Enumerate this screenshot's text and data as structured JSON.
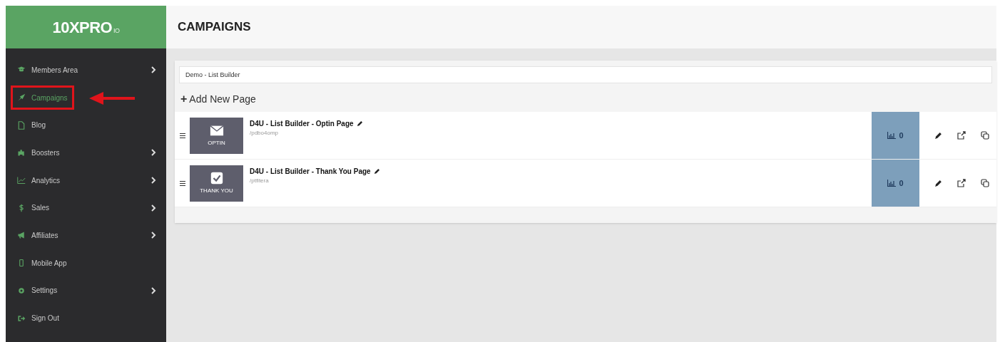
{
  "logo": {
    "text": "10XPRO",
    "suffix": "IO"
  },
  "sidebar": {
    "items": [
      {
        "label": "Members Area",
        "has_submenu": true,
        "selected": false,
        "highlighted": false
      },
      {
        "label": "Campaigns",
        "has_submenu": false,
        "selected": true,
        "highlighted": true
      },
      {
        "label": "Blog",
        "has_submenu": false,
        "selected": false,
        "highlighted": false
      },
      {
        "label": "Boosters",
        "has_submenu": true,
        "selected": false,
        "highlighted": false
      },
      {
        "label": "Analytics",
        "has_submenu": true,
        "selected": false,
        "highlighted": false
      },
      {
        "label": "Sales",
        "has_submenu": true,
        "selected": false,
        "highlighted": false
      },
      {
        "label": "Affiliates",
        "has_submenu": true,
        "selected": false,
        "highlighted": false
      },
      {
        "label": "Mobile App",
        "has_submenu": false,
        "selected": false,
        "highlighted": false
      },
      {
        "label": "Settings",
        "has_submenu": true,
        "selected": false,
        "highlighted": false
      },
      {
        "label": "Sign Out",
        "has_submenu": false,
        "selected": false,
        "highlighted": false
      }
    ]
  },
  "header": {
    "title": "CAMPAIGNS"
  },
  "campaign_field": {
    "value": "Demo - List Builder"
  },
  "add_page": {
    "icon": "+",
    "label": "Add New Page"
  },
  "pages": [
    {
      "kind": "optin",
      "thumb_label": "OPTIN",
      "title": "D4U - List Builder - Optin Page",
      "slug": "/pdbo4omp",
      "views": "0"
    },
    {
      "kind": "thankyou",
      "thumb_label": "THANK YOU",
      "title": "D4U - List Builder - Thank You Page",
      "slug": "/ptfitera",
      "views": "0"
    }
  ]
}
